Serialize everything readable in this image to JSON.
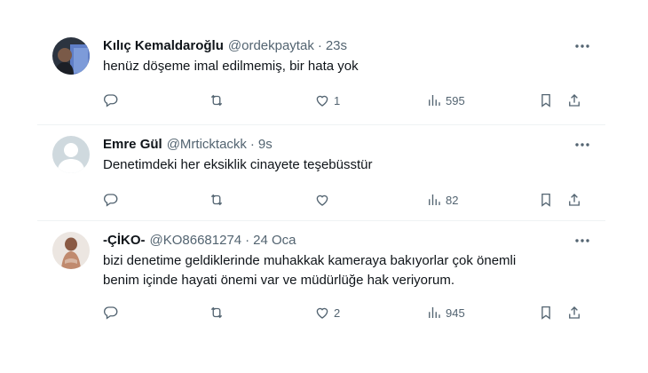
{
  "tweets": [
    {
      "name": "Kılıç Kemaldaroğlu",
      "handle": "@ordekpaytak",
      "sep": "·",
      "time": "23s",
      "text": "henüz döşeme imal edilmemiş, bir hata yok",
      "replies": "",
      "retweets": "",
      "likes": "1",
      "views": "595"
    },
    {
      "name": "Emre Gül",
      "handle": "@Mrticktackk",
      "sep": "·",
      "time": "9s",
      "text": "Denetimdeki her eksiklik cinayete teşebüsstür",
      "replies": "",
      "retweets": "",
      "likes": "",
      "views": "82"
    },
    {
      "name": "-ÇİKO-",
      "handle": "@KO86681274",
      "sep": "·",
      "time": "24 Oca",
      "text": "bizi denetime geldiklerinde muhakkak kameraya bakıyorlar çok önemli\nbenim içinde hayati önemi var ve müdürlüğe hak veriyorum.",
      "replies": "",
      "retweets": "",
      "likes": "2",
      "views": "945"
    }
  ],
  "icons": {
    "more": "more-dots-icon",
    "reply": "reply-icon",
    "retweet": "retweet-icon",
    "like": "heart-icon",
    "views": "views-chart-icon",
    "bookmark": "bookmark-icon",
    "share": "share-icon"
  },
  "colors": {
    "text": "#0f1419",
    "secondary": "#536471",
    "divider": "#eff3f4"
  }
}
